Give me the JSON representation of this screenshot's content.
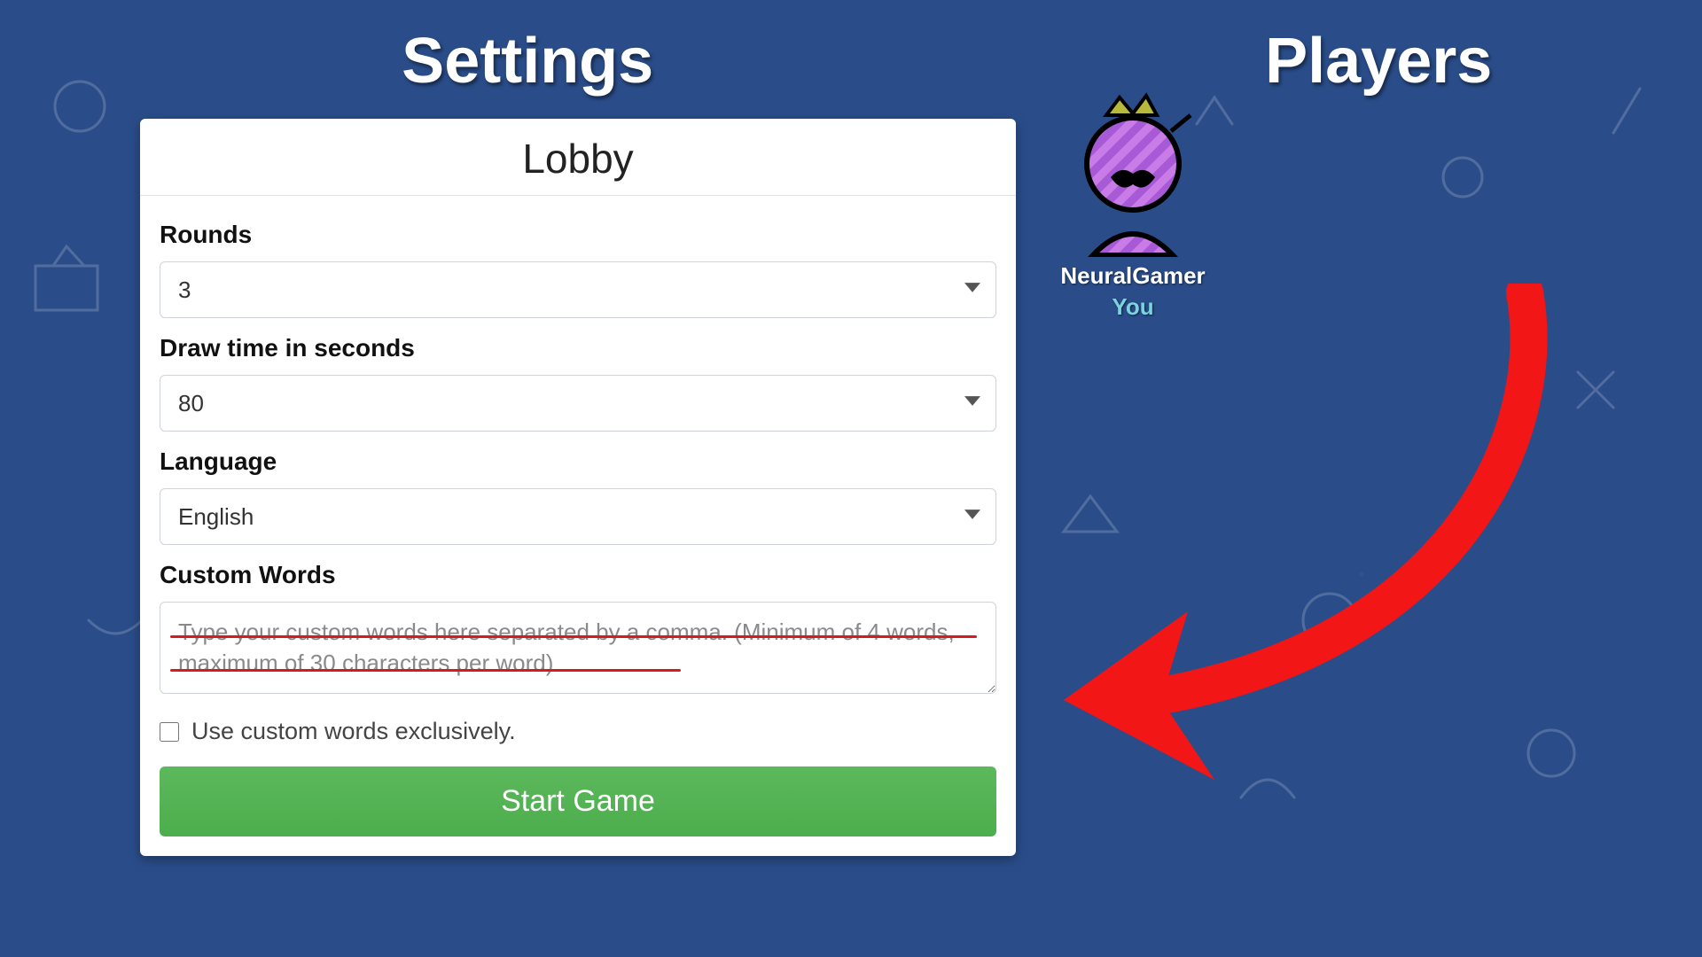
{
  "headers": {
    "settings": "Settings",
    "players": "Players"
  },
  "panel": {
    "title": "Lobby",
    "rounds_label": "Rounds",
    "rounds_value": "3",
    "drawtime_label": "Draw time in seconds",
    "drawtime_value": "80",
    "language_label": "Language",
    "language_value": "English",
    "customwords_label": "Custom Words",
    "customwords_placeholder": "Type your custom words here separated by a comma. (Minimum of 4 words, maximum of 30 characters per word)",
    "exclusive_label": "Use custom words exclusively.",
    "start_label": "Start Game"
  },
  "player": {
    "name": "NeuralGamer",
    "you": "You"
  }
}
